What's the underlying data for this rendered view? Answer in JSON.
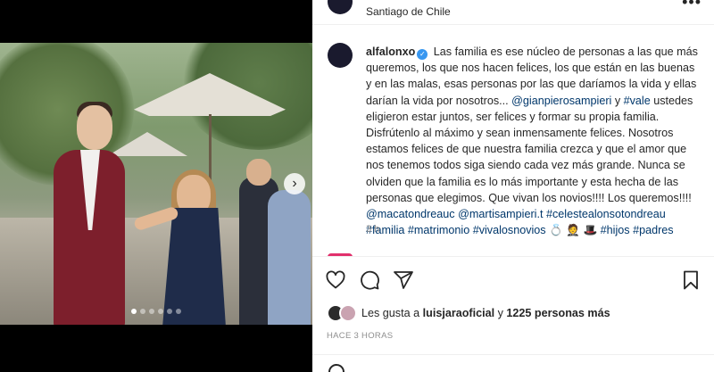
{
  "post": {
    "location": "Santiago de Chile",
    "username": "alfalonxo",
    "caption_parts": [
      {
        "type": "text",
        "value": " Las familia es ese núcleo de personas a las que más queremos, los que nos hacen felices, los que están en las buenas y en las malas, esas personas por las que daríamos la vida y ellas darían la vida por nosotros... "
      },
      {
        "type": "link",
        "value": "@gianpierosampieri"
      },
      {
        "type": "text",
        "value": " y "
      },
      {
        "type": "link",
        "value": "#vale"
      },
      {
        "type": "text",
        "value": " ustedes eligieron estar juntos, ser felices y formar su propia familia. Disfrútenlo al máximo y sean inmensamente felices. Nosotros estamos felices de que nuestra familia crezca y que el amor que nos tenemos todos siga siendo cada vez más grande. Nunca se olviden que la familia es lo más importante y esta hecha de las personas que elegimos. Que vivan los novios!!!! Los queremos!!!! "
      },
      {
        "type": "link",
        "value": "@macatondreauc"
      },
      {
        "type": "text",
        "value": " "
      },
      {
        "type": "link",
        "value": "@martisampieri.t"
      },
      {
        "type": "text",
        "value": " "
      },
      {
        "type": "link",
        "value": "#celestealonsotondreau"
      },
      {
        "type": "text",
        "value": " "
      },
      {
        "type": "link",
        "value": "#familia"
      },
      {
        "type": "text",
        "value": " "
      },
      {
        "type": "link",
        "value": "#matrimonio"
      },
      {
        "type": "text",
        "value": " "
      },
      {
        "type": "link",
        "value": "#vivalosnovios"
      },
      {
        "type": "text",
        "value": " 💍 🤵 🎩 "
      },
      {
        "type": "link",
        "value": "#hijos"
      },
      {
        "type": "text",
        "value": " "
      },
      {
        "type": "link",
        "value": "#padres"
      }
    ],
    "time_ago": "3 h",
    "likes_prefix": "Les gusta a ",
    "likes_user": "luisjaraoficial",
    "likes_mid": " y ",
    "likes_count": "1225 personas más",
    "date_label": "HACE 3 HORAS"
  },
  "carousel": {
    "slide_count": 6,
    "active_index": 0,
    "next_icon": "chevron-right-icon"
  },
  "icons": {
    "verified": "verified-badge-icon",
    "like": "heart-icon",
    "comment": "comment-icon",
    "share": "share-icon",
    "save": "bookmark-icon",
    "more": "more-options-icon"
  },
  "colors": {
    "link": "#00376b",
    "verified": "#3897f0",
    "muted": "#8e8e8e",
    "text": "#262626"
  }
}
